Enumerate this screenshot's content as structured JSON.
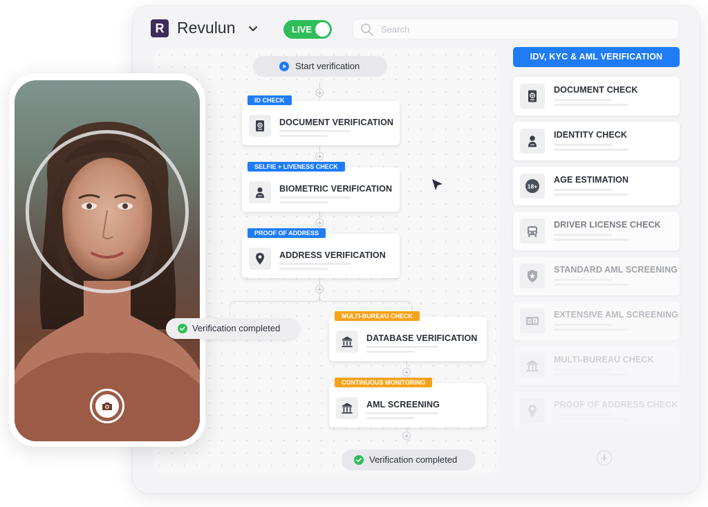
{
  "app": {
    "logo_letter": "R",
    "name": "Revulun",
    "live_label": "LIVE",
    "search_placeholder": "Search"
  },
  "workflow": {
    "start_label": "Start verification",
    "steps": [
      {
        "tag": "ID CHECK",
        "title": "DOCUMENT VERIFICATION",
        "icon": "passport-icon",
        "tag_color": "#1f7cf5"
      },
      {
        "tag": "SELFIE + LIVENESS CHECK",
        "title": "BIOMETRIC VERIFICATION",
        "icon": "person-icon",
        "tag_color": "#1f7cf5"
      },
      {
        "tag": "PROOF OF ADDRESS",
        "title": "ADDRESS VERIFICATION",
        "icon": "location-pin-icon",
        "tag_color": "#1f7cf5"
      },
      {
        "tag": "MULTI-BUREAU CHECK",
        "title": "DATABASE VERIFICATION",
        "icon": "bank-icon",
        "tag_color": "#f5a21b"
      },
      {
        "tag": "CONTINUOUS MONITORING",
        "title": "AML SCREENING",
        "icon": "bank-icon",
        "tag_color": "#f5a21b"
      }
    ],
    "completed_label_left": "Verification completed",
    "completed_label_bottom": "Verification completed"
  },
  "panel": {
    "header": "IDV, KYC & AML VERIFICATION",
    "items": [
      {
        "title": "DOCUMENT CHECK",
        "icon": "passport-icon"
      },
      {
        "title": "IDENTITY CHECK",
        "icon": "person-icon"
      },
      {
        "title": "AGE ESTIMATION",
        "icon": "age-18-plus-icon",
        "icon_text": "18+"
      },
      {
        "title": "DRIVER LICENSE CHECK",
        "icon": "car-icon"
      },
      {
        "title": "STANDARD AML SCREENING",
        "icon": "shield-star-icon"
      },
      {
        "title": "EXTENSIVE AML SCREENING",
        "icon": "id-card-icon"
      },
      {
        "title": "MULTI-BUREAU CHECK",
        "icon": "bank-icon"
      },
      {
        "title": "PROOF OF ADDRESS CHECK",
        "icon": "location-pin-icon"
      }
    ]
  },
  "colors": {
    "accent_blue": "#1f7cf5",
    "accent_orange": "#f5a21b",
    "live_green": "#2ebd5a",
    "logo_purple": "#3b2d5c"
  }
}
